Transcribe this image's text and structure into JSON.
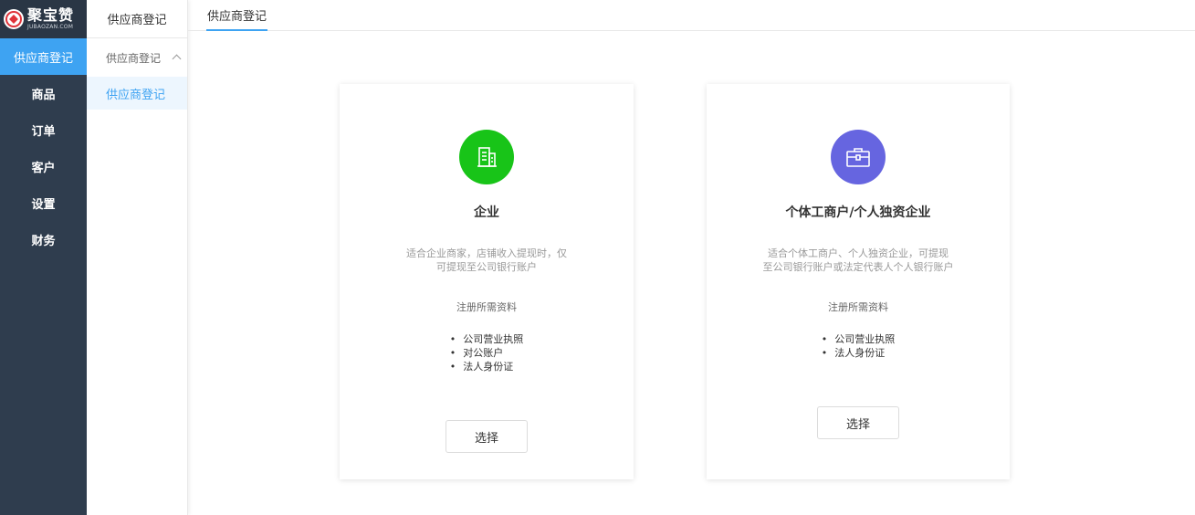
{
  "brand": {
    "title": "聚宝赞",
    "subtitle": "JUBAOZAN.COM"
  },
  "sidebar": {
    "items": [
      {
        "label": "供应商登记",
        "active": true
      },
      {
        "label": "商品"
      },
      {
        "label": "订单"
      },
      {
        "label": "客户"
      },
      {
        "label": "设置"
      },
      {
        "label": "财务"
      }
    ]
  },
  "subnav": {
    "header": "供应商登记",
    "group": "供应商登记",
    "item": "供应商登记"
  },
  "tabs": [
    {
      "label": "供应商登记"
    }
  ],
  "cards": [
    {
      "icon": "building-icon",
      "color": "#18c418",
      "title": "企业",
      "desc_line1": "适合企业商家，店铺收入提现时，仅",
      "desc_line2": "可提现至公司银行账户",
      "req_title": "注册所需资料",
      "requirements": [
        "公司营业执照",
        "对公账户",
        "法人身份证"
      ],
      "button": "选择"
    },
    {
      "icon": "briefcase-icon",
      "color": "#6665e0",
      "title": "个体工商户/个人独资企业",
      "desc_line1": "适合个体工商户、个人独资企业，可提现",
      "desc_line2": "至公司银行账户或法定代表人个人银行账户",
      "req_title": "注册所需资料",
      "requirements": [
        "公司营业执照",
        "法人身份证"
      ],
      "button": "选择"
    }
  ],
  "colors": {
    "accent": "#3ea3f2",
    "sidebar_bg": "#2f3d4e"
  }
}
